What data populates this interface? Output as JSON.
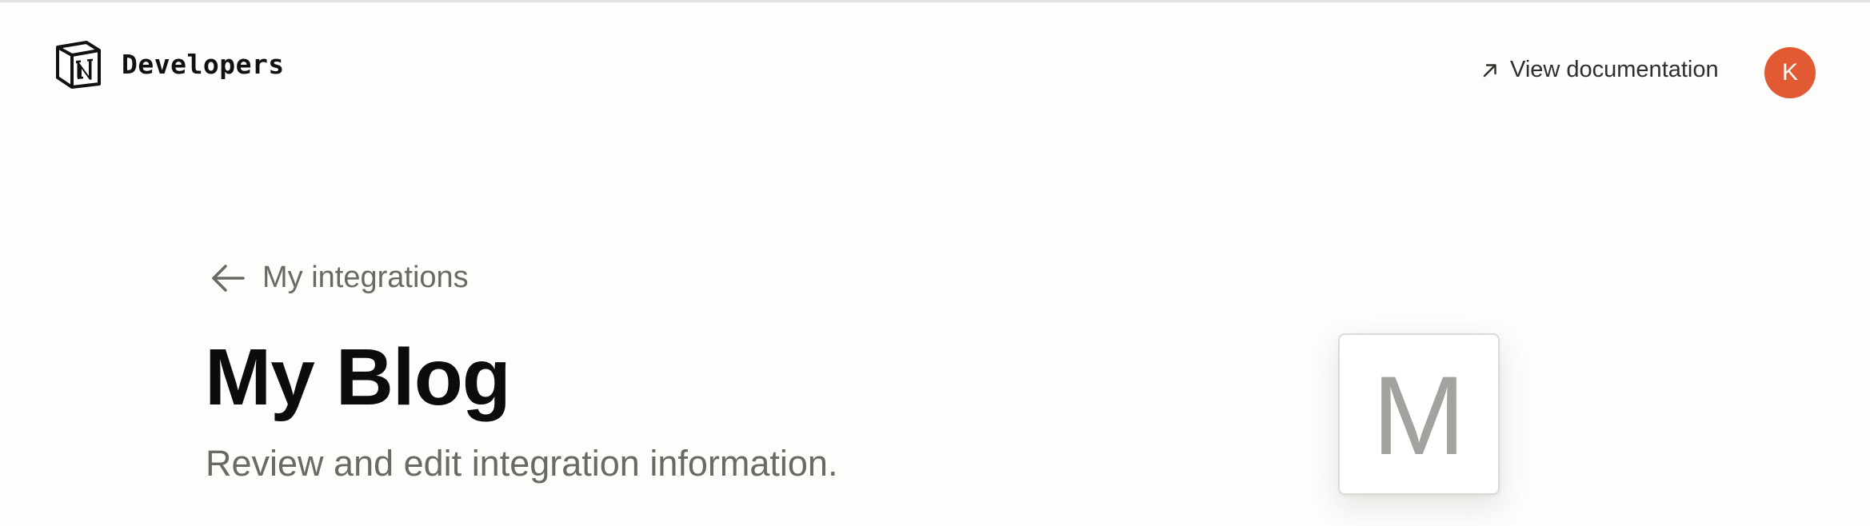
{
  "header": {
    "brand_name": "Developers",
    "doc_link_label": "View documentation",
    "avatar_initial": "K"
  },
  "main": {
    "back_link_label": "My integrations",
    "title": "My Blog",
    "subtitle": "Review and edit integration information.",
    "icon_letter": "M"
  },
  "colors": {
    "avatar": "#e15a33",
    "background": "#fdfdfc",
    "muted_text": "#6b6964",
    "icon_letter": "#a3a29e"
  },
  "icons": {
    "brand": "notion-logo-icon",
    "doc_link": "arrow-up-right-icon",
    "back": "arrow-left-icon"
  }
}
